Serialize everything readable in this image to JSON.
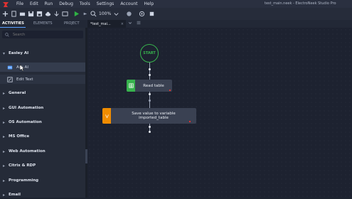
{
  "window": {
    "title": "test_main.neek - ElectroNeek Studio Pro"
  },
  "menu": [
    "File",
    "Edit",
    "Run",
    "Debug",
    "Tools",
    "Settings",
    "Account",
    "Help"
  ],
  "toolbar": {
    "zoom": "100%",
    "buttons": [
      "add-icon",
      "new-file-icon",
      "open-folder-icon",
      "save-icon",
      "save-all-icon",
      "cloud-icon",
      "download-icon",
      "export-icon",
      "run-icon",
      "debug-icon",
      "zoom-icon",
      "record-icon",
      "target-icon",
      "layers-icon"
    ]
  },
  "panel_tabs": [
    "ACTIVITIES",
    "ELEMENTS",
    "PROJECT"
  ],
  "doc_tab": {
    "label": "*test_mai...",
    "close": "×"
  },
  "search": {
    "placeholder": "Search",
    "value": ""
  },
  "categories": [
    {
      "name": "Easley AI",
      "expanded": true,
      "items": [
        {
          "label": "Ask AI",
          "icon": "ai-icon"
        },
        {
          "label": "Edit Text",
          "icon": "edit-text-icon"
        }
      ]
    },
    {
      "name": "General",
      "expanded": false
    },
    {
      "name": "GUI Automation",
      "expanded": false
    },
    {
      "name": "OS Automation",
      "expanded": false
    },
    {
      "name": "MS Office",
      "expanded": false
    },
    {
      "name": "Web Automation",
      "expanded": false
    },
    {
      "name": "Citrix & RDP",
      "expanded": false
    },
    {
      "name": "Programming",
      "expanded": false
    },
    {
      "name": "Email",
      "expanded": false
    }
  ],
  "canvas": {
    "start_label": "START",
    "blocks": [
      {
        "label": "Read table",
        "accent": "#37b24d"
      },
      {
        "label": "Save value to variable\nimported_table",
        "accent": "#f08c00"
      }
    ]
  },
  "colors": {
    "accent_blue": "#5aa0ff",
    "start_green": "#37b24d",
    "run_green": "#2fb344",
    "orange": "#f08c00",
    "error_red": "#e03131"
  }
}
